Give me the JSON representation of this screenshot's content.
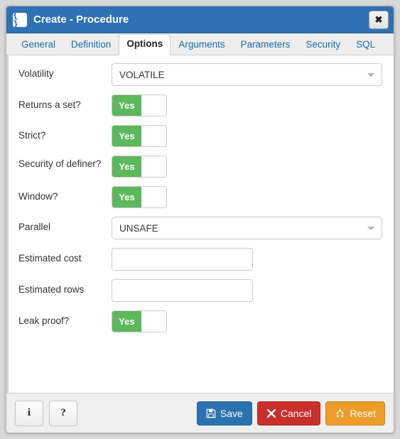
{
  "window": {
    "title": "Create - Procedure",
    "icon": "braces-icon",
    "close_label": "✖"
  },
  "tabs": [
    {
      "label": "General",
      "active": false
    },
    {
      "label": "Definition",
      "active": false
    },
    {
      "label": "Options",
      "active": true
    },
    {
      "label": "Arguments",
      "active": false
    },
    {
      "label": "Parameters",
      "active": false
    },
    {
      "label": "Security",
      "active": false
    },
    {
      "label": "SQL",
      "active": false
    }
  ],
  "form": {
    "rows": [
      {
        "name": "volatility",
        "label": "Volatility",
        "type": "select",
        "value": "VOLATILE"
      },
      {
        "name": "returns-a-set",
        "label": "Returns a set?",
        "type": "toggle",
        "value": "Yes"
      },
      {
        "name": "strict",
        "label": "Strict?",
        "type": "toggle",
        "value": "Yes"
      },
      {
        "name": "security-of-definer",
        "label": "Security of definer?",
        "type": "toggle",
        "value": "Yes"
      },
      {
        "name": "window",
        "label": "Window?",
        "type": "toggle",
        "value": "Yes"
      },
      {
        "name": "parallel",
        "label": "Parallel",
        "type": "select",
        "value": "UNSAFE"
      },
      {
        "name": "estimated-cost",
        "label": "Estimated cost",
        "type": "text",
        "value": "",
        "placeholder": ""
      },
      {
        "name": "estimated-rows",
        "label": "Estimated rows",
        "type": "text",
        "value": "",
        "placeholder": ""
      },
      {
        "name": "leak-proof",
        "label": "Leak proof?",
        "type": "toggle",
        "value": "Yes"
      }
    ]
  },
  "footer": {
    "info_label": "i",
    "help_label": "?",
    "save_label": "Save",
    "cancel_label": "Cancel",
    "reset_label": "Reset"
  },
  "colors": {
    "titlebar": "#2e71b4",
    "toggle_on": "#5cb85c",
    "save": "#2b72b0",
    "cancel": "#c9302c",
    "reset": "#ed9c28",
    "tab_link": "#1c6ba8"
  }
}
